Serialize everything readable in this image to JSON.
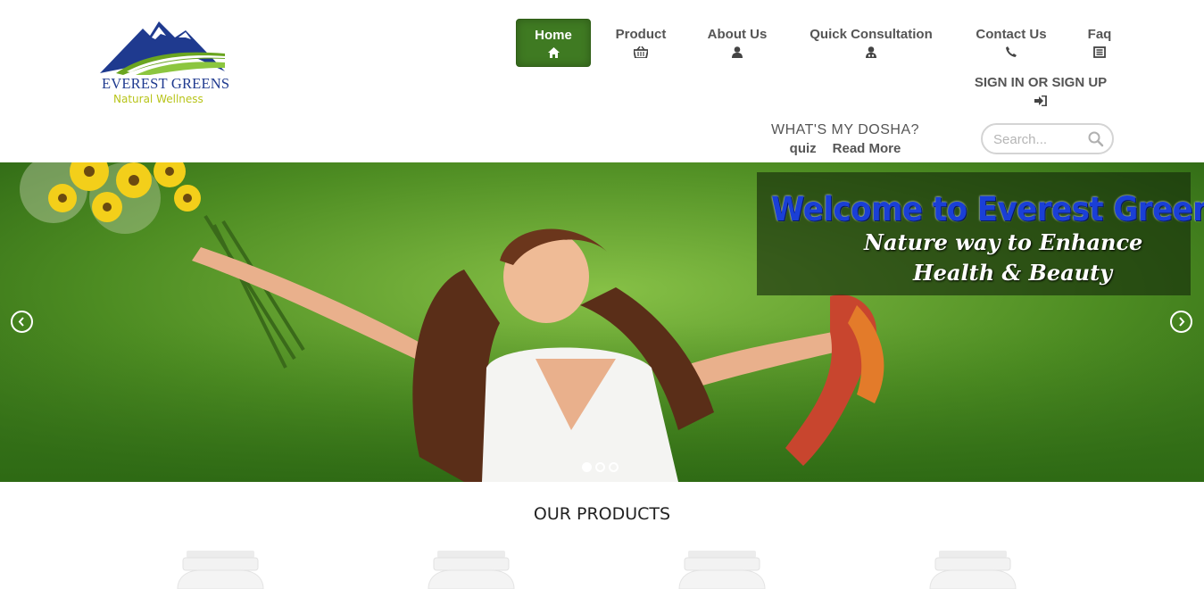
{
  "logo": {
    "title": "EVEREST GREENS",
    "subtitle": "Natural Wellness",
    "colors": {
      "mountain": "#1f3a8f",
      "field": "#6aa520",
      "subtitle": "#b8c41a"
    }
  },
  "nav": {
    "items": [
      {
        "label": "Home",
        "icon": "home-icon",
        "active": true
      },
      {
        "label": "Product",
        "icon": "basket-icon",
        "active": false
      },
      {
        "label": "About Us",
        "icon": "user-icon",
        "active": false
      },
      {
        "label": "Quick Consultation",
        "icon": "user-doctor-icon",
        "active": false
      },
      {
        "label": "Contact Us",
        "icon": "phone-icon",
        "active": false
      },
      {
        "label": "Faq",
        "icon": "document-icon",
        "active": false
      }
    ],
    "signin": {
      "label": "SIGN IN OR SIGN UP",
      "icon": "sign-in-icon"
    },
    "active_color": "#3f7a22"
  },
  "dosha": {
    "title": "WHAT'S MY DOSHA?",
    "quiz_label": "quiz",
    "read_more_label": "Read More"
  },
  "search": {
    "placeholder": "Search...",
    "icon": "search-icon"
  },
  "hero": {
    "welcome_title": "Welcome to Everest Green",
    "line2": "Nature way to Enhance",
    "line3": "Health & Beauty",
    "prev_icon": "chevron-left-icon",
    "next_icon": "chevron-right-icon",
    "slides": 3,
    "active_slide": 1,
    "colors": {
      "title": "#1a3fd6",
      "overlay": "rgba(20,40,10,0.62)"
    }
  },
  "products": {
    "title": "OUR PRODUCTS",
    "items": [
      {
        "icon": "product-bottle-icon"
      },
      {
        "icon": "product-bottle-icon"
      },
      {
        "icon": "product-bottle-icon"
      },
      {
        "icon": "product-bottle-icon"
      }
    ]
  }
}
